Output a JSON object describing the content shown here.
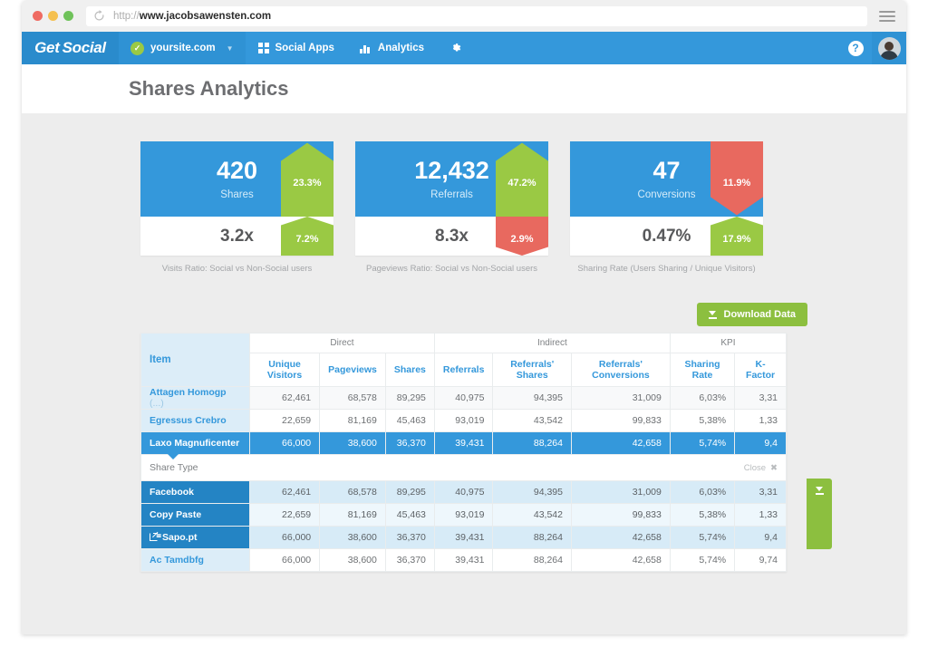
{
  "browser": {
    "url_scheme": "http://",
    "url_host": "www.jacobsawensten.com",
    "reload_icon": "reload-icon",
    "menu_icon": "hamburger-menu-icon"
  },
  "navbar": {
    "brand_part1": "Get",
    "brand_part2": "Social",
    "site_name": "yoursite.com",
    "site_badge_icon": "check-icon",
    "site_chevron_icon": "chevron-down-icon",
    "items": [
      {
        "label": "Social Apps",
        "icon": "grid-icon"
      },
      {
        "label": "Analytics",
        "icon": "bar-chart-icon"
      }
    ],
    "settings_icon": "gear-icon",
    "help_label": "?",
    "help_icon": "help-icon",
    "avatar_icon": "avatar"
  },
  "page": {
    "title": "Shares Analytics"
  },
  "cards": [
    {
      "value": "420",
      "label": "Shares",
      "ratio": "3.2x",
      "caption": "Visits Ratio: Social vs Non-Social users",
      "primary_delta": "23.3%",
      "primary_dir": "up",
      "primary_color": "#9ac944",
      "secondary_delta": "7.2%",
      "secondary_dir": "up",
      "secondary_color": "#9ac944"
    },
    {
      "value": "12,432",
      "label": "Referrals",
      "ratio": "8.3x",
      "caption": "Pageviews Ratio: Social vs Non-Social users",
      "primary_delta": "47.2%",
      "primary_dir": "up",
      "primary_color": "#9ac944",
      "secondary_delta": "2.9%",
      "secondary_dir": "down",
      "secondary_color": "#e8695f"
    },
    {
      "value": "47",
      "label": "Conversions",
      "ratio": "0.47%",
      "caption": "Sharing Rate (Users Sharing / Unique Visitors)",
      "primary_delta": "11.9%",
      "primary_dir": "down",
      "primary_color": "#e8695f",
      "secondary_delta": "17.9%",
      "secondary_dir": "up",
      "secondary_color": "#9ac944"
    }
  ],
  "toolbar": {
    "download_label": "Download Data",
    "download_icon": "download-icon"
  },
  "side_download": {
    "icon": "download-icon"
  },
  "table": {
    "group_headers": [
      {
        "label": "",
        "span": 1
      },
      {
        "label": "Direct",
        "span": 3
      },
      {
        "label": "Indirect",
        "span": 3
      },
      {
        "label": "KPI",
        "span": 2
      }
    ],
    "columns": [
      "Item",
      "Unique Visitors",
      "Pageviews",
      "Shares",
      "Referrals",
      "Referrals' Shares",
      "Referrals' Conversions",
      "Sharing Rate",
      "K-Factor"
    ],
    "rows": [
      {
        "item": "Attagen Homogp",
        "item_suffix": "(...)",
        "state": "zebra",
        "values": [
          "62,461",
          "68,578",
          "89,295",
          "40,975",
          "94,395",
          "31,009",
          "6,03%",
          "3,31"
        ]
      },
      {
        "item": "Egressus Crebro",
        "item_suffix": "",
        "state": "plain",
        "values": [
          "22,659",
          "81,169",
          "45,463",
          "93,019",
          "43,542",
          "99,833",
          "5,38%",
          "1,33"
        ]
      },
      {
        "item": "Laxo Magnuficenter",
        "item_suffix": "",
        "state": "selected",
        "values": [
          "66,000",
          "38,600",
          "36,370",
          "39,431",
          "88,264",
          "42,658",
          "5,74%",
          "9,4"
        ]
      }
    ],
    "expanded": {
      "label": "Share Type",
      "close_label": "Close",
      "close_icon": "close-icon",
      "rows": [
        {
          "item": "Facebook",
          "external": false,
          "state": "sub",
          "values": [
            "62,461",
            "68,578",
            "89,295",
            "40,975",
            "94,395",
            "31,009",
            "6,03%",
            "3,31"
          ]
        },
        {
          "item": "Copy Paste",
          "external": false,
          "state": "sub alt",
          "values": [
            "22,659",
            "81,169",
            "45,463",
            "93,019",
            "43,542",
            "99,833",
            "5,38%",
            "1,33"
          ]
        },
        {
          "item": "Sapo.pt",
          "external": true,
          "external_icon": "external-link-icon",
          "state": "sub",
          "values": [
            "66,000",
            "38,600",
            "36,370",
            "39,431",
            "88,264",
            "42,658",
            "5,74%",
            "9,4"
          ]
        }
      ]
    },
    "trailing_rows": [
      {
        "item": "Ac Tamdbfg",
        "item_suffix": "",
        "state": "plain",
        "values": [
          "66,000",
          "38,600",
          "36,370",
          "39,431",
          "88,264",
          "42,658",
          "5,74%",
          "9,74"
        ]
      }
    ]
  },
  "colors": {
    "brand_blue": "#3498db",
    "green": "#9ac944",
    "button_green": "#8cbf3f",
    "red": "#e8695f",
    "page_bg": "#ededed"
  }
}
